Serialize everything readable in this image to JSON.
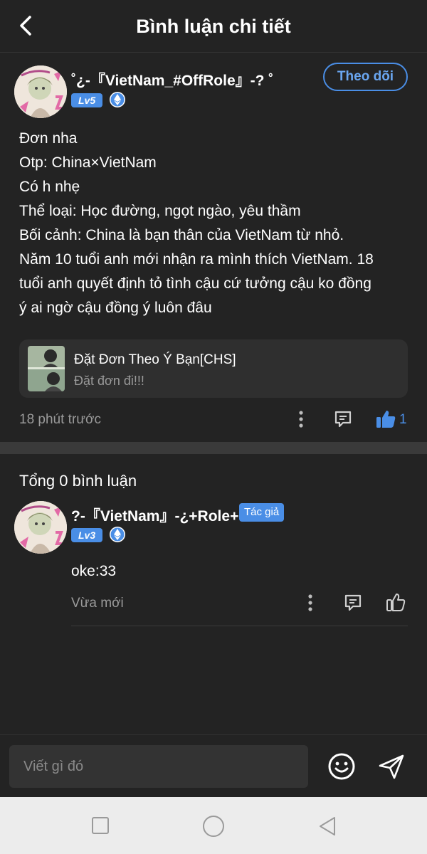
{
  "header": {
    "title": "Bình luận chi tiết"
  },
  "post": {
    "author": "˚¿-『VietNam_#OffRole』-? ˚",
    "level": "Lv5",
    "follow_label": "Theo dõi",
    "lines": [
      "Đơn nha",
      "Otp: China×VietNam",
      "Có h nhẹ",
      "Thể loại: Học đường, ngọt ngào, yêu thầm",
      "Bối cảnh: China là bạn thân của VietNam từ nhỏ.",
      "Năm 10 tuổi anh mới nhận ra mình thích VietNam. 18",
      "tuổi anh quyết định tỏ tình cậu cứ tưởng cậu ko đồng",
      "ý ai ngờ cậu đồng ý luôn đâu"
    ],
    "card": {
      "title": "Đặt Đơn Theo Ý Bạn[CHS]",
      "subtitle": "Đặt đơn đi!!!"
    },
    "time": "18 phút trước",
    "like_count": "1"
  },
  "comments": {
    "total_label": "Tổng 0 bình luận",
    "items": [
      {
        "author": "?-『VietNam』-¿+Role+",
        "author_tag": "Tác giả",
        "level": "Lv3",
        "text": "oke:33",
        "time": "Vừa mới"
      }
    ]
  },
  "composer": {
    "placeholder": "Viết gì đó"
  },
  "colors": {
    "accent": "#4a8ee6",
    "background": "#232323",
    "muted": "#9a9a9a"
  },
  "icons": {
    "back": "back-arrow-icon",
    "level_badge": "ethereum-badge-icon",
    "more": "more-vertical-icon",
    "reply": "comment-icon",
    "like": "thumbs-up-icon",
    "emoji": "smiley-icon",
    "send": "send-icon",
    "nav": [
      "square-icon",
      "circle-icon",
      "triangle-back-icon"
    ]
  }
}
